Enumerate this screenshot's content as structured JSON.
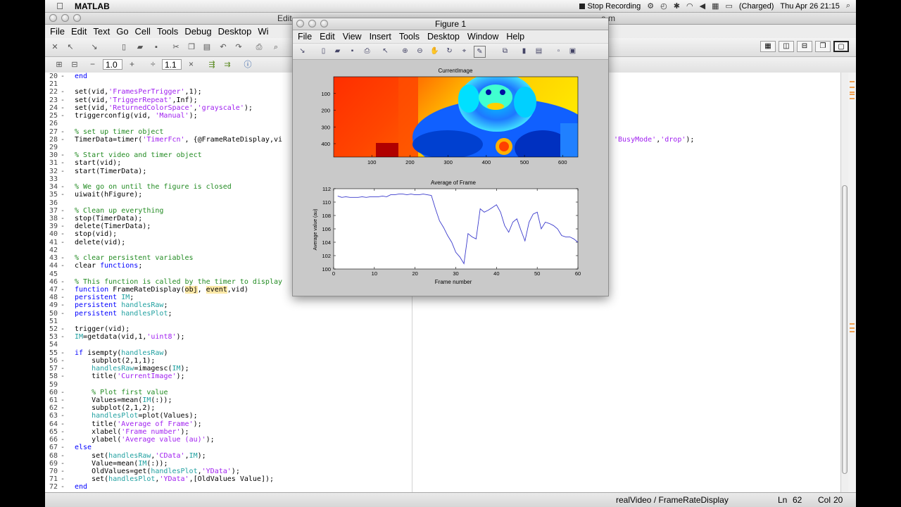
{
  "macbar": {
    "app": "MATLAB",
    "stop_recording": "Stop Recording",
    "battery": "(Charged)",
    "datetime": "Thu Apr 26  21:15"
  },
  "editor": {
    "title_left": "Edit",
    "title_right": "e.m",
    "menu": [
      "File",
      "Edit",
      "Text",
      "Go",
      "Cell",
      "Tools",
      "Debug",
      "Desktop",
      "Wi"
    ],
    "cell_toolbar": {
      "value1": "1.0",
      "value2": "1.1",
      "plus": "+",
      "divide": "÷",
      "times": "×",
      "minus": "−"
    },
    "code_lines": [
      {
        "n": "20",
        "t": [
          [
            "kw",
            "end"
          ]
        ]
      },
      {
        "n": "21",
        "t": []
      },
      {
        "n": "22",
        "t": [
          [
            "",
            "set(vid,"
          ],
          [
            "st",
            "'FramesPerTrigger'"
          ],
          [
            "",
            ",1);"
          ]
        ]
      },
      {
        "n": "23",
        "t": [
          [
            "",
            "set(vid,"
          ],
          [
            "st",
            "'TriggerRepeat'"
          ],
          [
            "",
            ",Inf);"
          ]
        ]
      },
      {
        "n": "24",
        "t": [
          [
            "",
            "set(vid,"
          ],
          [
            "st",
            "'ReturnedColorSpace'"
          ],
          [
            "",
            ","
          ],
          [
            "st",
            "'grayscale'"
          ],
          [
            "",
            ");"
          ]
        ]
      },
      {
        "n": "25",
        "t": [
          [
            "",
            "triggerconfig(vid, "
          ],
          [
            "st",
            "'Manual'"
          ],
          [
            "",
            ");"
          ]
        ]
      },
      {
        "n": "26",
        "t": []
      },
      {
        "n": "27",
        "t": [
          [
            "cm",
            "% set up timer object"
          ]
        ]
      },
      {
        "n": "28",
        "t": [
          [
            "",
            "TimerData=timer("
          ],
          [
            "st",
            "'TimerFcn'"
          ],
          [
            "",
            ", {@FrameRateDisplay,vi"
          ]
        ]
      },
      {
        "n": "29",
        "t": []
      },
      {
        "n": "30",
        "t": [
          [
            "cm",
            "% Start video and timer object"
          ]
        ]
      },
      {
        "n": "31",
        "t": [
          [
            "",
            "start(vid);"
          ]
        ]
      },
      {
        "n": "32",
        "t": [
          [
            "",
            "start(TimerData);"
          ]
        ]
      },
      {
        "n": "33",
        "t": []
      },
      {
        "n": "34",
        "t": [
          [
            "cm",
            "% We go on until the figure is closed"
          ]
        ]
      },
      {
        "n": "35",
        "t": [
          [
            "",
            "uiwait(hFigure);"
          ]
        ]
      },
      {
        "n": "36",
        "t": []
      },
      {
        "n": "37",
        "t": [
          [
            "cm",
            "% Clean up everything"
          ]
        ]
      },
      {
        "n": "38",
        "t": [
          [
            "",
            "stop(TimerData);"
          ]
        ]
      },
      {
        "n": "39",
        "t": [
          [
            "",
            "delete(TimerData);"
          ]
        ]
      },
      {
        "n": "40",
        "t": [
          [
            "",
            "stop(vid);"
          ]
        ]
      },
      {
        "n": "41",
        "t": [
          [
            "",
            "delete(vid);"
          ]
        ]
      },
      {
        "n": "42",
        "t": []
      },
      {
        "n": "43",
        "t": [
          [
            "cm",
            "% clear persistent variables"
          ]
        ]
      },
      {
        "n": "44",
        "t": [
          [
            "",
            "clear "
          ],
          [
            "kw",
            "functions"
          ],
          [
            "",
            ";"
          ]
        ]
      },
      {
        "n": "45",
        "t": []
      },
      {
        "n": "46",
        "t": [
          [
            "cm",
            "% This function is called by the timer to display"
          ]
        ]
      },
      {
        "n": "47",
        "t": [
          [
            "kw",
            "function"
          ],
          [
            "",
            " FrameRateDisplay("
          ],
          [
            "hl",
            "obj"
          ],
          [
            "",
            ", "
          ],
          [
            "hl",
            "event"
          ],
          [
            "",
            ",vid)"
          ]
        ]
      },
      {
        "n": "48",
        "t": [
          [
            "kw",
            "persistent"
          ],
          [
            "",
            " "
          ],
          [
            "pv",
            "IM"
          ],
          [
            "",
            ";"
          ]
        ]
      },
      {
        "n": "49",
        "t": [
          [
            "kw",
            "persistent"
          ],
          [
            "",
            " "
          ],
          [
            "pv",
            "handlesRaw"
          ],
          [
            "",
            ";"
          ]
        ]
      },
      {
        "n": "50",
        "t": [
          [
            "kw",
            "persistent"
          ],
          [
            "",
            " "
          ],
          [
            "pv",
            "handlesPlot"
          ],
          [
            "",
            ";"
          ]
        ]
      },
      {
        "n": "51",
        "t": []
      },
      {
        "n": "52",
        "t": [
          [
            "",
            "trigger(vid);"
          ]
        ]
      },
      {
        "n": "53",
        "t": [
          [
            "pv",
            "IM"
          ],
          [
            "",
            "=getdata(vid,1,"
          ],
          [
            "st",
            "'uint8'"
          ],
          [
            "",
            ");"
          ]
        ]
      },
      {
        "n": "54",
        "t": []
      },
      {
        "n": "55",
        "t": [
          [
            "kw",
            "if"
          ],
          [
            "",
            " isempty("
          ],
          [
            "pv",
            "handlesRaw"
          ],
          [
            "",
            ")"
          ]
        ]
      },
      {
        "n": "56",
        "t": [
          [
            "",
            "    subplot(2,1,1);"
          ]
        ]
      },
      {
        "n": "57",
        "t": [
          [
            "",
            "    "
          ],
          [
            "pv",
            "handlesRaw"
          ],
          [
            "",
            "=imagesc("
          ],
          [
            "pv",
            "IM"
          ],
          [
            "",
            ");"
          ]
        ]
      },
      {
        "n": "58",
        "t": [
          [
            "",
            "    title("
          ],
          [
            "st",
            "'CurrentImage'"
          ],
          [
            "",
            ");"
          ]
        ]
      },
      {
        "n": "59",
        "t": []
      },
      {
        "n": "60",
        "t": [
          [
            "",
            "    "
          ],
          [
            "cm",
            "% Plot first value"
          ]
        ]
      },
      {
        "n": "61",
        "t": [
          [
            "",
            "    Values=mean("
          ],
          [
            "pv",
            "IM"
          ],
          [
            "",
            "(:));"
          ]
        ]
      },
      {
        "n": "62",
        "t": [
          [
            "",
            "    subplot(2,1,2);"
          ]
        ]
      },
      {
        "n": "63",
        "t": [
          [
            "",
            "    "
          ],
          [
            "pv",
            "handlesPlot"
          ],
          [
            "",
            "=plot(Values);"
          ]
        ]
      },
      {
        "n": "64",
        "t": [
          [
            "",
            "    title("
          ],
          [
            "st",
            "'Average of Frame'"
          ],
          [
            "",
            ");"
          ]
        ]
      },
      {
        "n": "65",
        "t": [
          [
            "",
            "    xlabel("
          ],
          [
            "st",
            "'Frame number'"
          ],
          [
            "",
            ");"
          ]
        ]
      },
      {
        "n": "66",
        "t": [
          [
            "",
            "    ylabel("
          ],
          [
            "st",
            "'Average value (au)'"
          ],
          [
            "",
            ");"
          ]
        ]
      },
      {
        "n": "67",
        "t": [
          [
            "kw",
            "else"
          ]
        ]
      },
      {
        "n": "68",
        "t": [
          [
            "",
            "    set("
          ],
          [
            "pv",
            "handlesRaw"
          ],
          [
            "",
            ","
          ],
          [
            "st",
            "'CData'"
          ],
          [
            "",
            ","
          ],
          [
            "pv",
            "IM"
          ],
          [
            "",
            ");"
          ]
        ]
      },
      {
        "n": "69",
        "t": [
          [
            "",
            "    Value=mean("
          ],
          [
            "pv",
            "IM"
          ],
          [
            "",
            "(:));"
          ]
        ]
      },
      {
        "n": "70",
        "t": [
          [
            "",
            "    OldValues=get("
          ],
          [
            "pv",
            "handlesPlot"
          ],
          [
            "",
            ","
          ],
          [
            "st",
            "'YData'"
          ],
          [
            "",
            ");"
          ]
        ]
      },
      {
        "n": "71",
        "t": [
          [
            "",
            "    set("
          ],
          [
            "pv",
            "handlesPlot"
          ],
          [
            "",
            ","
          ],
          [
            "st",
            "'YData'"
          ],
          [
            "",
            ",[OldValues Value]);"
          ]
        ]
      },
      {
        "n": "72",
        "t": [
          [
            "kw",
            "end"
          ]
        ]
      }
    ],
    "line28_tail": [
      [
        "st",
        "'BusyMode'"
      ],
      [
        "",
        ","
      ],
      [
        "st",
        "'drop'"
      ],
      [
        "",
        ");"
      ]
    ],
    "status": {
      "path": "realVideo / FrameRateDisplay",
      "ln_label": "Ln",
      "ln": "62",
      "col_label": "Col",
      "col": "20"
    }
  },
  "figure": {
    "title": "Figure 1",
    "menu": [
      "File",
      "Edit",
      "View",
      "Insert",
      "Tools",
      "Desktop",
      "Window",
      "Help"
    ],
    "image_plot": {
      "title": "CurrentImage",
      "yticks": [
        "100",
        "200",
        "300",
        "400"
      ],
      "xticks": [
        "100",
        "200",
        "300",
        "400",
        "500",
        "600"
      ]
    },
    "colors": {
      "jet_low": "#0000ff",
      "jet_mid": "#ffff00",
      "jet_high": "#ff0000",
      "plot_line": "#3a3acc"
    }
  },
  "chart_data": {
    "type": "line",
    "title": "Average of Frame",
    "xlabel": "Frame number",
    "ylabel": "Average value (au)",
    "xlim": [
      0,
      60
    ],
    "ylim": [
      100,
      112
    ],
    "xticks": [
      0,
      10,
      20,
      30,
      40,
      50,
      60
    ],
    "yticks": [
      100,
      102,
      104,
      106,
      108,
      110,
      112
    ],
    "grid": false,
    "series": [
      {
        "x": [
          1,
          2,
          3,
          4,
          5,
          6,
          7,
          8,
          9,
          10,
          11,
          12,
          13,
          14,
          15,
          16,
          17,
          18,
          19,
          20,
          21,
          22,
          23,
          24,
          25,
          26,
          27,
          28,
          29,
          30,
          31,
          32,
          33,
          34,
          35,
          36,
          37,
          38,
          39,
          40,
          41,
          42,
          43,
          44,
          45,
          46,
          47,
          48,
          49,
          50,
          51,
          52,
          53,
          54,
          55,
          56,
          57,
          58,
          59,
          60
        ],
        "values": [
          110.9,
          110.7,
          110.8,
          110.7,
          110.7,
          110.7,
          110.8,
          110.7,
          110.8,
          110.8,
          110.8,
          110.9,
          110.8,
          111.1,
          111.1,
          111.2,
          111.2,
          111.1,
          111.2,
          111.1,
          111.1,
          111.2,
          111.1,
          111.0,
          109.0,
          107.2,
          106.2,
          105.0,
          104.0,
          102.5,
          101.8,
          100.8,
          105.3,
          104.8,
          104.5,
          109.0,
          108.5,
          108.8,
          109.2,
          109.6,
          108.5,
          106.5,
          105.5,
          107.0,
          107.5,
          105.8,
          104.2,
          107.0,
          108.2,
          108.5,
          106.0,
          107.0,
          106.8,
          106.5,
          106.0,
          105.0,
          104.8,
          104.8,
          104.5,
          104.0
        ]
      }
    ]
  }
}
